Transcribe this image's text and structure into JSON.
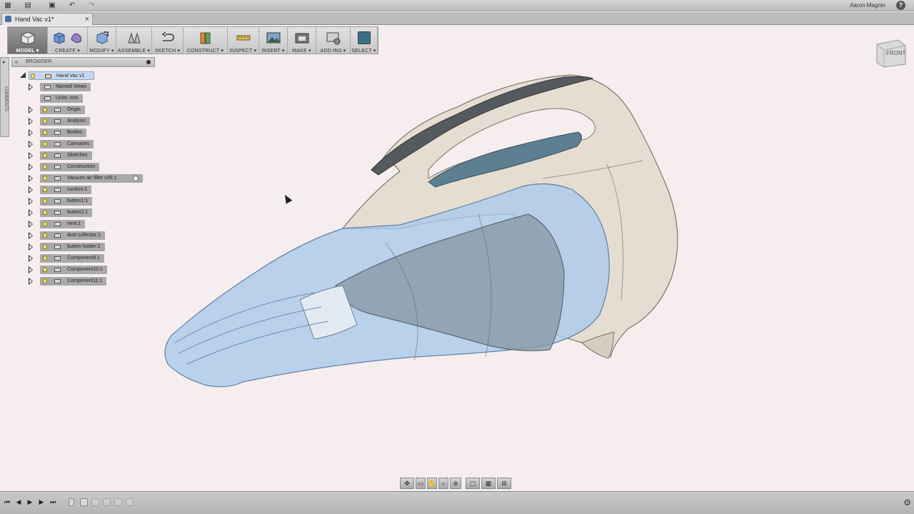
{
  "app": {
    "user_name": "Aaron Magnin",
    "help_symbol": "?"
  },
  "tab": {
    "title": "Hand Vac v1*",
    "close_symbol": "×"
  },
  "toolbar": {
    "workspace": "MODEL ▾",
    "items": [
      {
        "label": "CREATE ▾"
      },
      {
        "label": "MODIFY ▾"
      },
      {
        "label": "ASSEMBLE ▾"
      },
      {
        "label": "SKETCH ▾"
      },
      {
        "label": "CONSTRUCT ▾"
      },
      {
        "label": "INSPECT ▾"
      },
      {
        "label": "INSERT ▾"
      },
      {
        "label": "MAKE ▾"
      },
      {
        "label": "ADD-INS ▾"
      },
      {
        "label": "SELECT ▾"
      }
    ]
  },
  "comments_label": "COMMENTS",
  "browser": {
    "header": "BROWSER",
    "root": "Hand Vac v1",
    "items": [
      {
        "label": "Named Views"
      },
      {
        "label": "Units: mm"
      },
      {
        "label": "Origin"
      },
      {
        "label": "Analysis"
      },
      {
        "label": "Bodies"
      },
      {
        "label": "Canvases"
      },
      {
        "label": "Sketches"
      },
      {
        "label": "Construction"
      },
      {
        "label": "Vacuum air filter v26:1"
      },
      {
        "label": "suction:1"
      },
      {
        "label": "button1:1"
      },
      {
        "label": "button2:1"
      },
      {
        "label": "vent:1"
      },
      {
        "label": "dust collector:1"
      },
      {
        "label": "button holder:1"
      },
      {
        "label": "Component9:1"
      },
      {
        "label": "Component10:1"
      },
      {
        "label": "Component11:1"
      }
    ]
  },
  "viewcube": {
    "face": "FRONT"
  },
  "colors": {
    "viewport_bg": "#f6eeee",
    "shell_beige": "#e6ddd2",
    "clear_blue": "#a9c9ec",
    "accent": "#3c6e87"
  },
  "icons": [
    "grid-icon",
    "file-icon",
    "save-icon",
    "undo-icon",
    "redo-icon",
    "help-icon",
    "lightbulb-icon",
    "folder-icon",
    "component-icon",
    "orbit-icon",
    "pan-icon",
    "zoom-icon",
    "fit-icon",
    "display-settings-icon",
    "grid-settings-icon",
    "viewports-icon",
    "play-icon",
    "step-back-icon",
    "step-forward-icon",
    "gear-icon"
  ]
}
